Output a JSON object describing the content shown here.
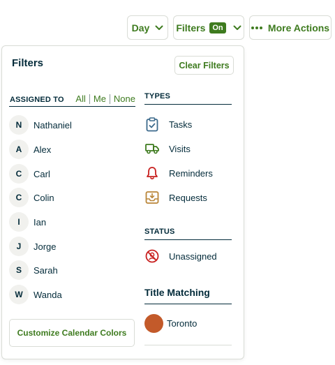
{
  "toolbar": {
    "day_label": "Day",
    "filters_label": "Filters",
    "filters_badge": "On",
    "more_label": "More Actions"
  },
  "panel": {
    "title": "Filters",
    "clear_label": "Clear Filters",
    "assigned": {
      "heading": "ASSIGNED TO",
      "links": {
        "all": "All",
        "me": "Me",
        "none": "None"
      },
      "people": [
        {
          "initial": "N",
          "name": "Nathaniel"
        },
        {
          "initial": "A",
          "name": "Alex"
        },
        {
          "initial": "C",
          "name": "Carl"
        },
        {
          "initial": "C",
          "name": "Colin"
        },
        {
          "initial": "I",
          "name": "Ian"
        },
        {
          "initial": "J",
          "name": "Jorge"
        },
        {
          "initial": "S",
          "name": "Sarah"
        },
        {
          "initial": "W",
          "name": "Wanda"
        }
      ]
    },
    "customize_label": "Customize Calendar Colors",
    "types": {
      "heading": "TYPES",
      "items": [
        {
          "label": "Tasks",
          "icon": "clipboard-check-icon",
          "color": "#3c6a8c"
        },
        {
          "label": "Visits",
          "icon": "truck-icon",
          "color": "#3e7b1f"
        },
        {
          "label": "Reminders",
          "icon": "bell-icon",
          "color": "#c8201f"
        },
        {
          "label": "Requests",
          "icon": "inbox-download-icon",
          "color": "#b98538"
        }
      ]
    },
    "status": {
      "heading": "STATUS",
      "items": [
        {
          "label": "Unassigned",
          "icon": "user-slash-icon",
          "color": "#c8201f"
        }
      ]
    },
    "title_matching": {
      "heading": "Title Matching",
      "items": [
        {
          "label": "Toronto",
          "color": "#c35a2a"
        }
      ]
    }
  },
  "colors": {
    "accent_green": "#3e7b1f",
    "text_dark": "#032b3a",
    "border": "#d9dcd6"
  }
}
